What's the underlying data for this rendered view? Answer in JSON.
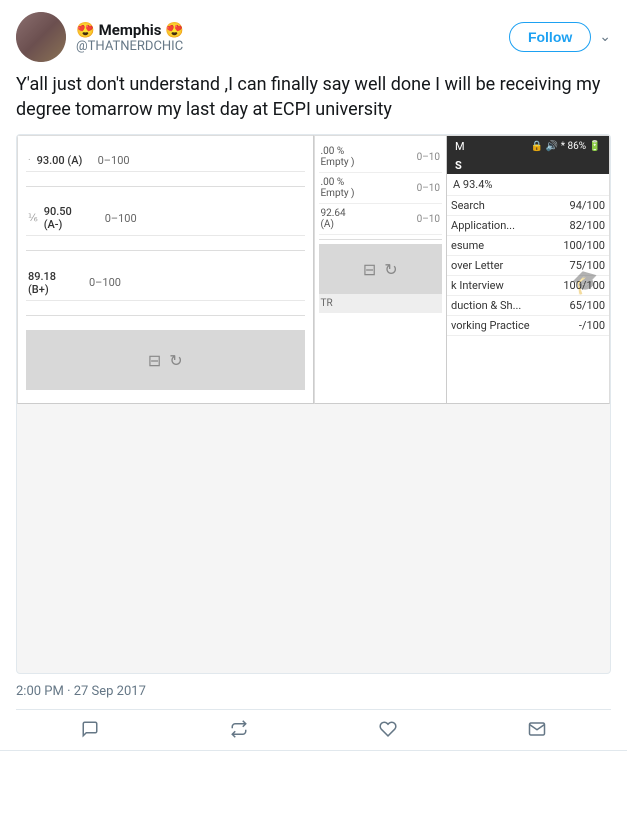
{
  "header": {
    "display_name": "Memphis",
    "screen_name": "@THATNERDCHIC",
    "follow_label": "Follow",
    "emoji_left": "😍",
    "emoji_right": "😍"
  },
  "tweet": {
    "text": "Y'all just don't understand ,I can finally say well done I will be receiving my degree tomarrow my last day at ECPI university",
    "timestamp": "2:00 PM · 27 Sep 2017"
  },
  "grades_left": {
    "rows": [
      {
        "score": "93.00 (A)",
        "range": "0–100"
      },
      {
        "score": "90.50\n(A-)",
        "range": "0–100"
      },
      {
        "score": "89.18\n(B+)",
        "range": "0–100"
      }
    ]
  },
  "grades_middle": {
    "rows": [
      {
        "score": ".00 %\nEmpty )",
        "range": "0–10"
      },
      {
        "score": ".00 %\nEmpty )",
        "range": "0–10"
      },
      {
        "score": "92.64\n(A)",
        "range": "0–10"
      }
    ]
  },
  "grades_right_top": {
    "status_time": "",
    "status_icons": "🔒 🔊 * 86%",
    "letter": "S",
    "overall": "A  93.4%"
  },
  "grades_right_bottom": {
    "rows": [
      {
        "label": "Search",
        "score": "94/100"
      },
      {
        "label": "Application...",
        "score": "82/100"
      },
      {
        "label": "esume",
        "score": "100/100"
      },
      {
        "label": "over Letter",
        "score": "75/100"
      },
      {
        "label": "k Interview",
        "score": "100/100"
      },
      {
        "label": "duction & Sh...",
        "score": "65/100"
      },
      {
        "label": "vorking Practice",
        "score": "-/100"
      }
    ]
  },
  "actions": {
    "reply": "💬",
    "retweet": "🔁",
    "like": "♡",
    "mail": "✉"
  }
}
